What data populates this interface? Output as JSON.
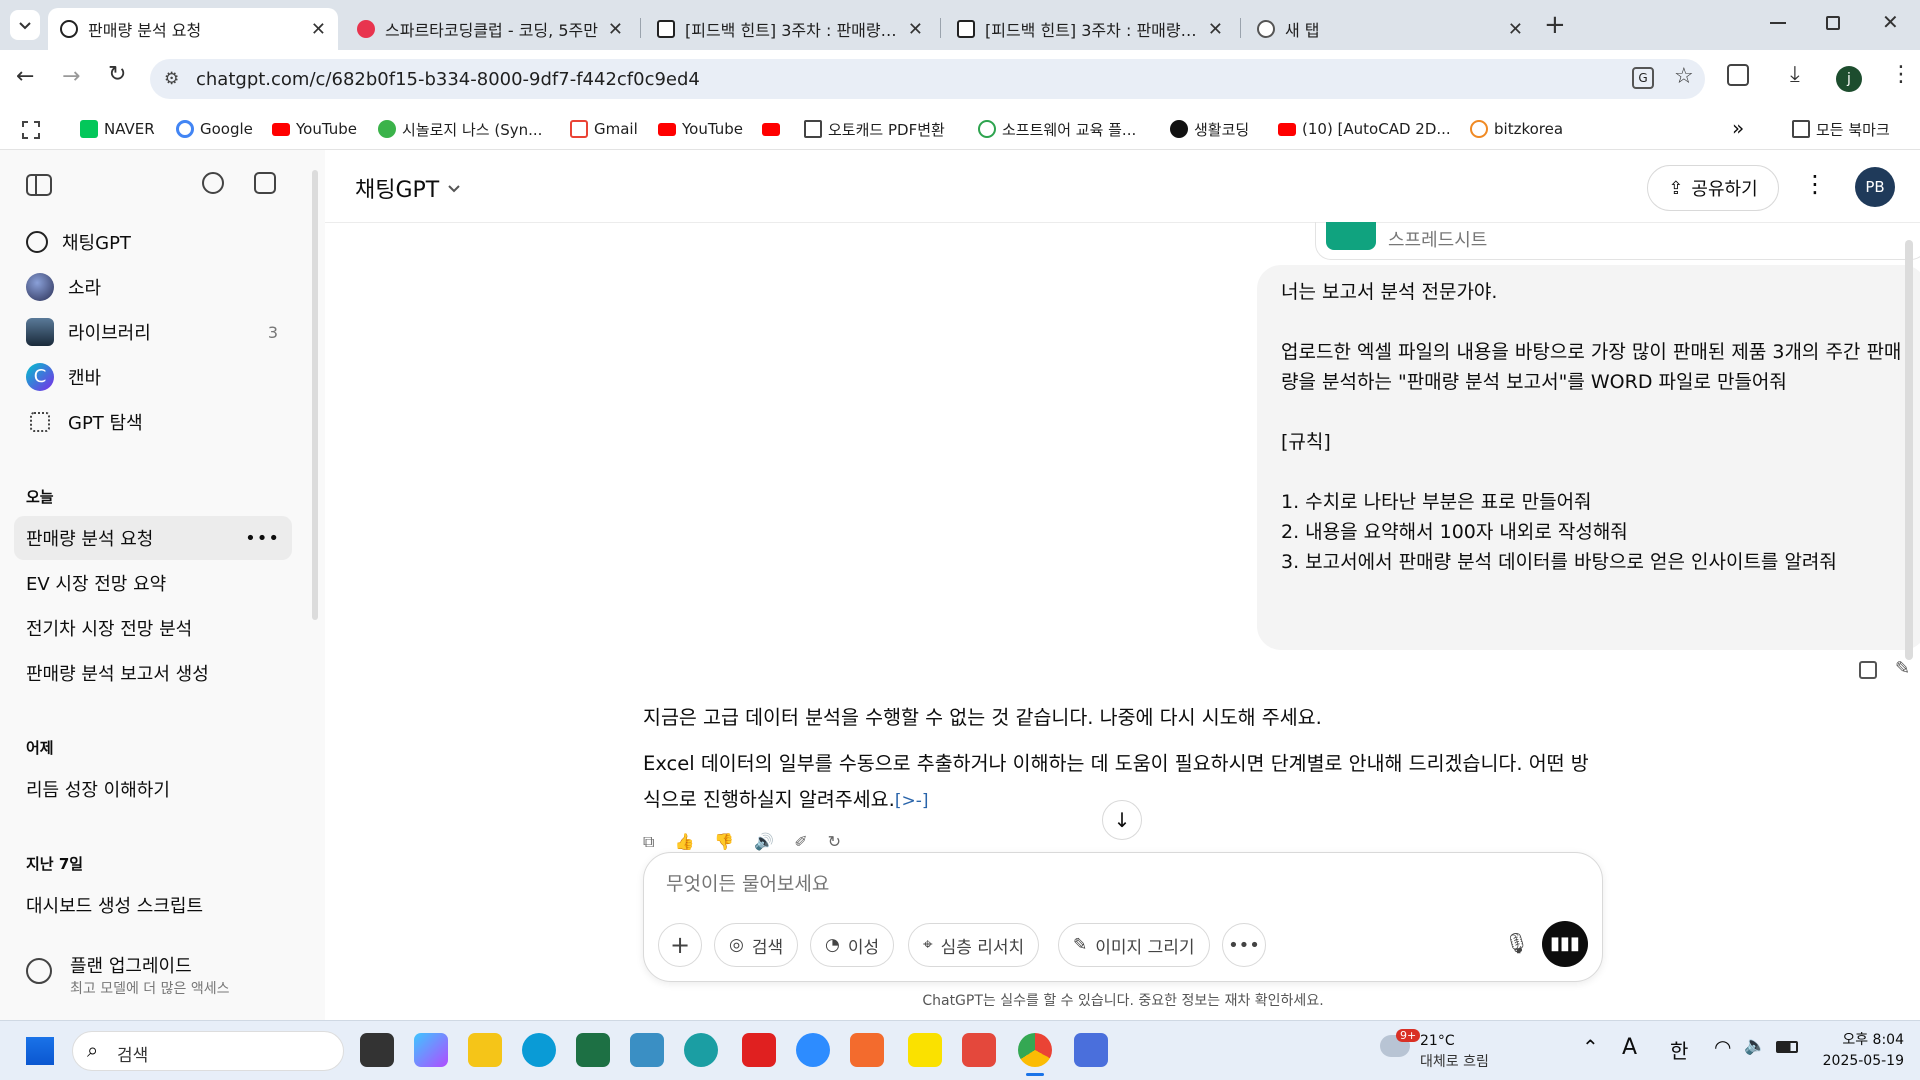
{
  "browser": {
    "tabs": [
      {
        "title": "판매량 분석 요청",
        "active": true
      },
      {
        "title": "스파르타코딩클럽 - 코딩, 5주만",
        "active": false
      },
      {
        "title": "[피드백 힌트] 3주차 : 판매량 분",
        "active": false
      },
      {
        "title": "[피드백 힌트] 3주차 : 판매량 분",
        "active": false
      },
      {
        "title": "새 탭",
        "active": false
      }
    ],
    "url": "chatgpt.com/c/682b0f15-b334-8000-9df7-f442cf0c9ed4",
    "bookmarks": [
      "NAVER",
      "Google",
      "YouTube",
      "시놀로지 나스 (Syn...",
      "Gmail",
      "YouTube",
      "",
      "오토캐드 PDF변환",
      "소프트웨어 교육 플...",
      "생활코딩",
      "(10) [AutoCAD 2D...",
      "bitzkorea"
    ],
    "all_bookmarks": "모든 북마크"
  },
  "sidebar": {
    "nav": [
      {
        "label": "채팅GPT"
      },
      {
        "label": "소라"
      },
      {
        "label": "라이브러리",
        "count": "3"
      },
      {
        "label": "캔바"
      },
      {
        "label": "GPT 탐색"
      }
    ],
    "today_label": "오늘",
    "today": [
      "판매량 분석 요청",
      "EV 시장 전망 요약",
      "전기차 시장 전망 분석",
      "판매량 분석 보고서 생성"
    ],
    "yesterday_label": "어제",
    "yesterday": [
      "리듬 성장 이해하기"
    ],
    "week_label": "지난 7일",
    "week": [
      "대시보드 생성 스크립트"
    ],
    "upgrade_title": "플랜 업그레이드",
    "upgrade_sub": "최고 모델에 더 많은 액세스"
  },
  "header": {
    "model": "채팅GPT",
    "share": "공유하기",
    "avatar": "PB"
  },
  "conversation": {
    "attachment_label": "스프레드시트",
    "user_message": "너는 보고서 분석 전문가야.\n\n업로드한 엑셀 파일의 내용을 바탕으로 가장 많이 판매된 제품 3개의 주간 판매량을 분석하는 \"판매량 분석 보고서\"를 WORD 파일로 만들어줘\n\n[규칙]\n\n1. 수치로 나타난 부분은 표로 만들어줘\n2. 내용을 요약해서 100자 내외로 작성해줘\n3. 보고서에서 판매량 분석 데이터를 바탕으로 얻은 인사이트를 알려줘",
    "response_1": "지금은 고급 데이터 분석을 수행할 수 없는 것 같습니다. 나중에 다시 시도해 주세요.",
    "response_2": "Excel 데이터의 일부를 수동으로 추출하거나 이해하는 데 도움이 필요하시면 단계별로 안내해 드리겠습니다. 어떤 방식으로 진행하실지 알려주세요.",
    "response_link": "[>-]"
  },
  "composer": {
    "placeholder": "무엇이든 물어보세요",
    "chips": [
      "검색",
      "이성",
      "심층 리서치",
      "이미지 그리기"
    ],
    "disclaimer": "ChatGPT는 실수를 할 수 있습니다. 중요한 정보는 재차 확인하세요."
  },
  "taskbar": {
    "search": "검색",
    "weather_temp": "21°C",
    "weather_desc": "대체로 흐림",
    "weather_badge": "9+",
    "ime_a": "A",
    "ime_han": "한",
    "time": "오후 8:04",
    "date": "2025-05-19"
  },
  "colors": {
    "accent": "#10a37f",
    "tab_bg": "#dde3ea",
    "taskbar": "#e7eef8"
  }
}
